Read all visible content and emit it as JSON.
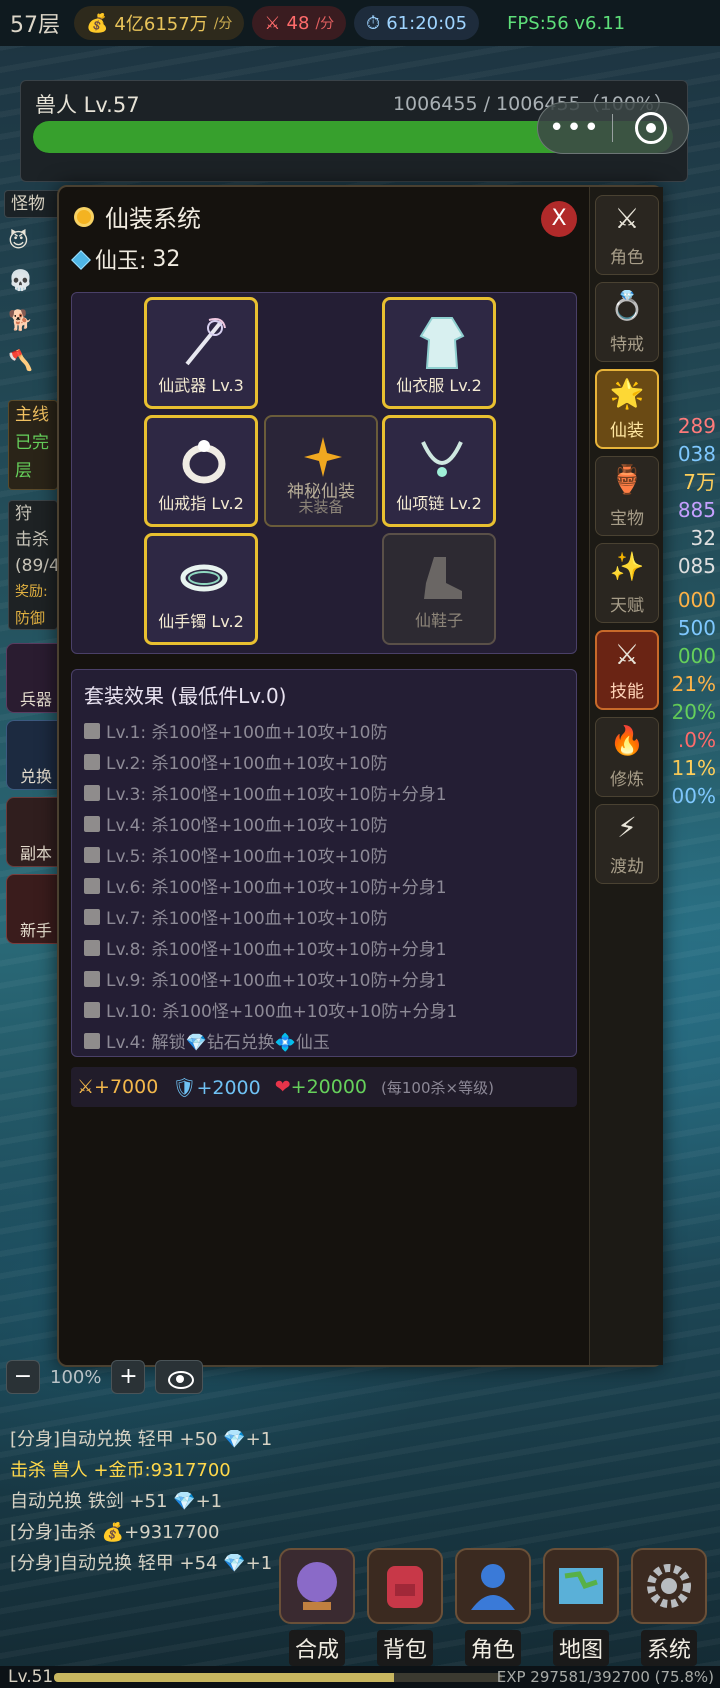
{
  "topbar": {
    "floor": "57层",
    "gold": "4亿6157万",
    "gold_unit": "/分",
    "kills": "48",
    "kills_unit": "/分",
    "timer": "61:20:05",
    "fps": "FPS:56 v6.11"
  },
  "monster": {
    "name": "兽人 Lv.57",
    "hp_text": "1006455 / 1006455（100%）",
    "hp_fraction": 1.0
  },
  "left": {
    "tag": "怪物",
    "buttons": [
      "兵器",
      "兑换",
      "副本",
      "新手"
    ],
    "quest_lines": [
      "主线",
      "已完",
      "层"
    ],
    "hunt_lines": [
      "狩",
      "击杀",
      "(89/4",
      "奖励:",
      "防御"
    ]
  },
  "right_stats": [
    "289",
    "038",
    "7万",
    "885",
    "32",
    "085",
    "000",
    "500",
    "000",
    "21%",
    "20%",
    ".0%",
    "11%",
    "00%"
  ],
  "modal": {
    "title": "仙装系统",
    "jade_label": "仙玉:",
    "jade_value": "32",
    "close_label": "X",
    "slots": {
      "weapon": "仙武器 Lv.3",
      "clothes": "仙衣服 Lv.2",
      "ring": "仙戒指 Lv.2",
      "mystery_name": "神秘仙装",
      "mystery_sub": "未装备",
      "necklace": "仙项链 Lv.2",
      "bracelet": "仙手镯 Lv.2",
      "shoes": "仙鞋子"
    },
    "set_title": "套装效果 (最低件Lv.0)",
    "set_rows": [
      "Lv.1: 杀100怪+100血+10攻+10防",
      "Lv.2: 杀100怪+100血+10攻+10防",
      "Lv.3: 杀100怪+100血+10攻+10防+分身1",
      "Lv.4: 杀100怪+100血+10攻+10防",
      "Lv.5: 杀100怪+100血+10攻+10防",
      "Lv.6: 杀100怪+100血+10攻+10防+分身1",
      "Lv.7: 杀100怪+100血+10攻+10防",
      "Lv.8: 杀100怪+100血+10攻+10防+分身1",
      "Lv.9: 杀100怪+100血+10攻+10防+分身1",
      "Lv.10: 杀100怪+100血+10攻+10防+分身1",
      "Lv.4: 解锁💎钻石兑换💠仙玉"
    ],
    "bonus": {
      "atk": "+7000",
      "def": "+2000",
      "hp": "+20000",
      "note": "(每100杀×等级)"
    },
    "tabs": [
      "角色",
      "特戒",
      "仙装",
      "宝物",
      "天赋",
      "技能",
      "修炼",
      "渡劫"
    ]
  },
  "zoom": {
    "minus": "−",
    "value": "100%",
    "plus": "+"
  },
  "log": [
    "[分身]自动兑换 轻甲 +50 💎+1",
    "击杀 兽人 +金币:9317700",
    "自动兑换 铁剑 +51 💎+1",
    "[分身]击杀 💰+9317700",
    "[分身]自动兑换 轻甲 +54 💎+1"
  ],
  "nav": [
    "合成",
    "背包",
    "角色",
    "地图",
    "系统"
  ],
  "exp": {
    "level": "Lv.51",
    "text": "EXP 297581/392700 (75.8%)",
    "fraction": 0.758
  },
  "colors": {
    "accent_gold": "#e8c030",
    "hp_green": "#37a02d",
    "panel_purple": "#241e34"
  }
}
